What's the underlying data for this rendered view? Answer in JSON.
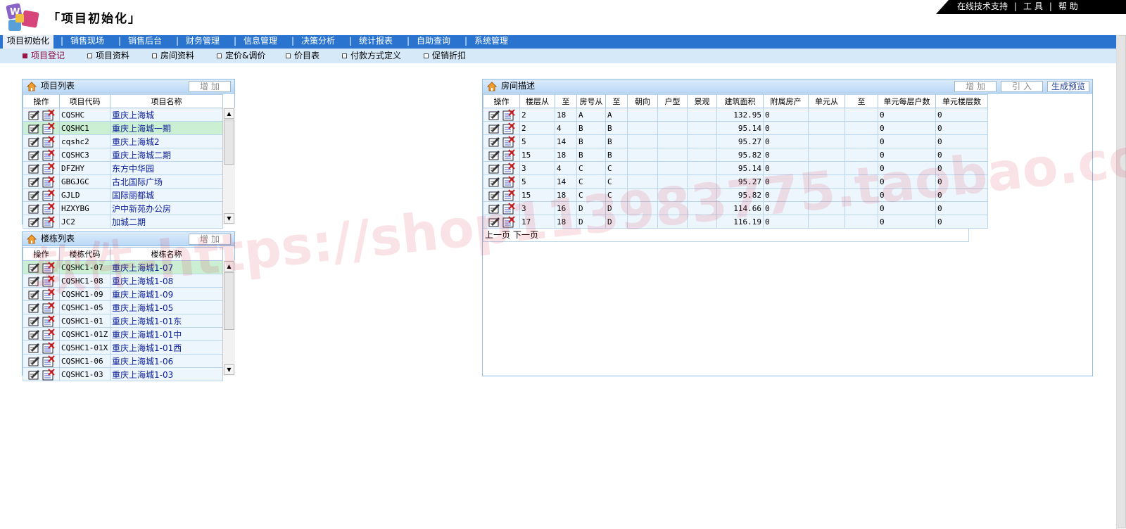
{
  "app": {
    "title": "「项目初始化」"
  },
  "toplinks": [
    "在线技术支持",
    "工 具",
    "帮 助"
  ],
  "mainmenu": [
    "项目初始化",
    "销售现场",
    "销售后台",
    "财务管理",
    "信息管理",
    "决策分析",
    "统计报表",
    "自助查询",
    "系统管理"
  ],
  "submenu": [
    "项目登记",
    "项目资料",
    "房间资料",
    "定价&调价",
    "价目表",
    "付款方式定义",
    "促销折扣"
  ],
  "project_panel": {
    "title": "项目列表",
    "add_label": "增加",
    "headers": [
      "操作",
      "项目代码",
      "项目名称"
    ],
    "rows": [
      {
        "code": "CQSHC",
        "name": "重庆上海城"
      },
      {
        "code": "CQSHC1",
        "name": "重庆上海城一期"
      },
      {
        "code": "cqshc2",
        "name": "重庆上海城2"
      },
      {
        "code": "CQSHC3",
        "name": "重庆上海城二期"
      },
      {
        "code": "DFZHY",
        "name": "东方中华园"
      },
      {
        "code": "GBGJGC",
        "name": "古北国际广场"
      },
      {
        "code": "GJLD",
        "name": "国际丽都城"
      },
      {
        "code": "HZXYBG",
        "name": "沪中新苑办公房"
      },
      {
        "code": "JC2",
        "name": "加城二期"
      }
    ]
  },
  "building_panel": {
    "title": "楼栋列表",
    "add_label": "增加",
    "headers": [
      "操作",
      "楼栋代码",
      "楼栋名称"
    ],
    "rows": [
      {
        "code": "CQSHC1-07",
        "name": "重庆上海城1-07"
      },
      {
        "code": "CQSHC1-08",
        "name": "重庆上海城1-08"
      },
      {
        "code": "CQSHC1-09",
        "name": "重庆上海城1-09"
      },
      {
        "code": "CQSHC1-05",
        "name": "重庆上海城1-05"
      },
      {
        "code": "CQSHC1-01",
        "name": "重庆上海城1-01东"
      },
      {
        "code": "CQSHC1-01Z",
        "name": "重庆上海城1-01中"
      },
      {
        "code": "CQSHC1-01X",
        "name": "重庆上海城1-01西"
      },
      {
        "code": "CQSHC1-06",
        "name": "重庆上海城1-06"
      },
      {
        "code": "CQSHC1-03",
        "name": "重庆上海城1-03"
      }
    ]
  },
  "room_panel": {
    "title": "房间描述",
    "add_label": "增加",
    "import_label": "引入",
    "preview_label": "生成预览",
    "headers": [
      "操作",
      "楼层从",
      "至",
      "房号从",
      "至",
      "朝向",
      "户型",
      "景观",
      "建筑面积",
      "附属房产",
      "单元从",
      "至",
      "单元每层户数",
      "单元楼层数"
    ],
    "rows": [
      {
        "floor_from": "2",
        "floor_to": "18",
        "room_from": "A",
        "room_to": "A",
        "area": "132.95",
        "attached": "0",
        "per_floor": "0",
        "unit_floors": "0"
      },
      {
        "floor_from": "2",
        "floor_to": "4",
        "room_from": "B",
        "room_to": "B",
        "area": "95.14",
        "attached": "0",
        "per_floor": "0",
        "unit_floors": "0"
      },
      {
        "floor_from": "5",
        "floor_to": "14",
        "room_from": "B",
        "room_to": "B",
        "area": "95.27",
        "attached": "0",
        "per_floor": "0",
        "unit_floors": "0"
      },
      {
        "floor_from": "15",
        "floor_to": "18",
        "room_from": "B",
        "room_to": "B",
        "area": "95.82",
        "attached": "0",
        "per_floor": "0",
        "unit_floors": "0"
      },
      {
        "floor_from": "3",
        "floor_to": "4",
        "room_from": "C",
        "room_to": "C",
        "area": "95.14",
        "attached": "0",
        "per_floor": "0",
        "unit_floors": "0"
      },
      {
        "floor_from": "5",
        "floor_to": "14",
        "room_from": "C",
        "room_to": "C",
        "area": "95.27",
        "attached": "0",
        "per_floor": "0",
        "unit_floors": "0"
      },
      {
        "floor_from": "15",
        "floor_to": "18",
        "room_from": "C",
        "room_to": "C",
        "area": "95.82",
        "attached": "0",
        "per_floor": "0",
        "unit_floors": "0"
      },
      {
        "floor_from": "3",
        "floor_to": "16",
        "room_from": "D",
        "room_to": "D",
        "area": "114.66",
        "attached": "0",
        "per_floor": "0",
        "unit_floors": "0"
      },
      {
        "floor_from": "17",
        "floor_to": "18",
        "room_from": "D",
        "room_to": "D",
        "area": "116.19",
        "attached": "0",
        "per_floor": "0",
        "unit_floors": "0"
      }
    ],
    "prev_label": "上一页",
    "next_label": "下一页"
  },
  "watermark": "软件-https://shop113983775.taobao.com"
}
